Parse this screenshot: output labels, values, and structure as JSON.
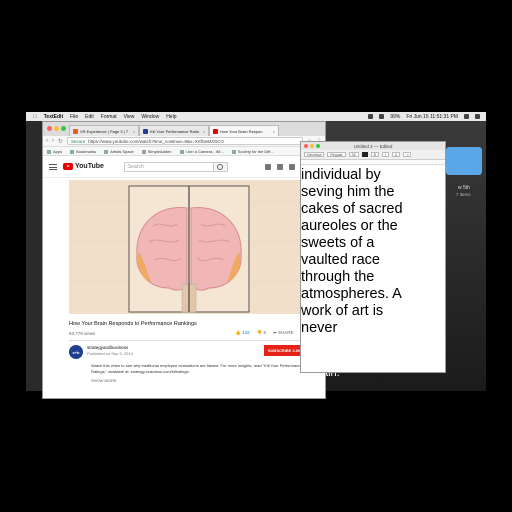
{
  "menubar": {
    "app": "TextEdit",
    "items": [
      "File",
      "Edit",
      "Format",
      "View",
      "Window",
      "Help"
    ],
    "battery": "99%",
    "datetime": "Fri Jun 15  11:51:31 PM"
  },
  "desktop": {
    "folder_label": "w 5th",
    "folder_sub": "7 items",
    "caption": "ain."
  },
  "browser": {
    "tabs": [
      {
        "label": "VR Experience | Page 3 | T",
        "color": "#e25b2b"
      },
      {
        "label": "Kill Your Performance Ratin",
        "color": "#1f3f8f"
      },
      {
        "label": "How Your Brain Respon",
        "color": "#e00000"
      }
    ],
    "url_secure": "Secure",
    "url": "https://www.youtube.com/watch?time_continue=8&v=XrtfSeMXSCO",
    "bookmarks": [
      "Apps",
      "Bookmarks",
      "Artists Space",
      "SimpleAdden",
      "I Am a Camera - Wi...",
      "Society for the Diff..."
    ]
  },
  "youtube": {
    "logo": "YouTube",
    "search_placeholder": "Search",
    "video_title": "How Your Brain Responds to Performance Rankings",
    "views": "63,779 views",
    "likes": "142",
    "dislikes": "6",
    "share": "SHARE",
    "channel": "strategyandbusiness",
    "avatar": "s+b",
    "published": "Published on Sep 5, 2014",
    "subscribe": "SUBSCRIBE  3.6K",
    "description": "Watch this video to see why traditional employee evaluations are flawed. For more insights, read \"Kill Your Performance Ratings,\" available at: strategy-business.com/killratings.",
    "show_more": "SHOW MORE"
  },
  "textedit": {
    "title": "Untitled 2 — Edited",
    "font": "Helvetica",
    "style": "Regular",
    "size": "36",
    "body": "individual by\nseving him the\ncakes of sacred\naureoles or the\nsweets of a\nvaulted race\nthrough the\natmospheres. A\nwork of art is\nnever"
  }
}
